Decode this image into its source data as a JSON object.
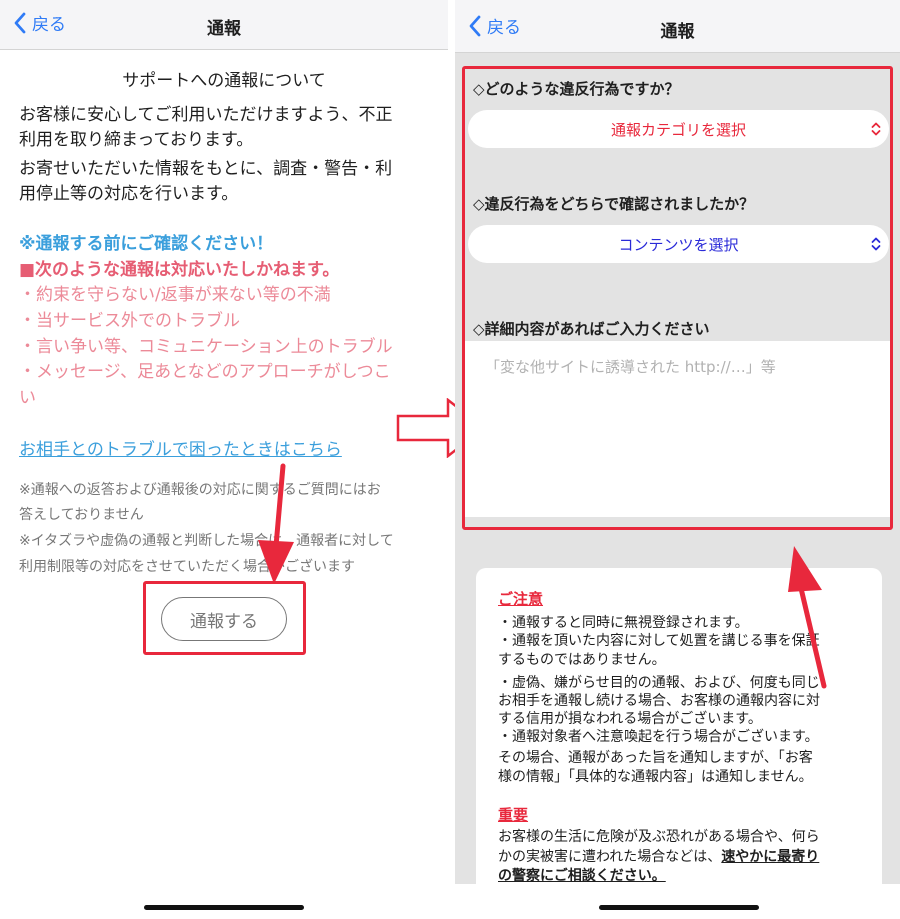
{
  "left": {
    "nav": {
      "back_label": "戻る",
      "title": "通報"
    },
    "heading": "サポートへの通報について",
    "intro_lines": [
      "お客様に安心してご利用いただけますよう、不正",
      "利用を取り締まっております。",
      "お寄せいただいた情報をもとに、調査・警告・利",
      "用停止等の対応を行います。"
    ],
    "confirm_notice": "※通報する前にご確認ください！",
    "cannot_handle": "■次のような通報は対応いたしかねます。",
    "examples": [
      "・約束を守らない/返事が来ない等の不満",
      "・当サービス外でのトラブル",
      "・言い争い等、コミュニケーション上のトラブル",
      "・メッセージ、足あとなどのアプローチがしつこ",
      "い"
    ],
    "trouble_link": "お相手とのトラブルで困ったときはこちら",
    "notes": [
      "※通報への返答および通報後の対応に関するご質問にはお",
      "答えしておりません",
      "※イタズラや虚偽の通報と判断した場合は、通報者に対して",
      "利用制限等の対応をさせていただく場合がございます"
    ],
    "report_button": "通報する"
  },
  "right": {
    "nav": {
      "back_label": "戻る",
      "title": "通報"
    },
    "q1": "◇どのような違反行為ですか？",
    "q1_select": "通報カテゴリを選択",
    "q2": "◇違反行為をどちらで確認されましたか？",
    "q2_select": "コンテンツを選択",
    "q3": "◇詳細内容があればご入力ください",
    "details_placeholder": "「変な他サイトに誘導された http://…」等",
    "caution_title": "ご注意",
    "caution_lines": [
      "・通報すると同時に無視登録されます。",
      "・通報を頂いた内容に対して処置を講じる事を保証",
      "するものではありません。",
      "・虚偽、嫌がらせ目的の通報、および、何度も同じ",
      "お相手を通報し続ける場合、お客様の通報内容に対",
      "する信用が損なわれる場合がございます。",
      "・通報対象者へ注意喚起を行う場合がございます。",
      "その場合、通報があった旨を通知しますが、「お客",
      "様の情報」「具体的な通報内容」は通知しません。"
    ],
    "important_title": "重要",
    "important_line1": "お客様の生活に危険が及ぶ恐れがある場合や、何ら",
    "important_line2a": "かの実被害に遭われた場合などは、",
    "important_line2b": "速やかに最寄り",
    "important_line3": "の警察にご相談ください。"
  },
  "colors": {
    "ios_blue": "#2f7bf6",
    "notice_blue": "#3b9fdc",
    "alert_red": "#e65d73",
    "highlight_red": "#e8283c",
    "select_red": "#e8283c",
    "select_blue": "#2a2ad8"
  }
}
